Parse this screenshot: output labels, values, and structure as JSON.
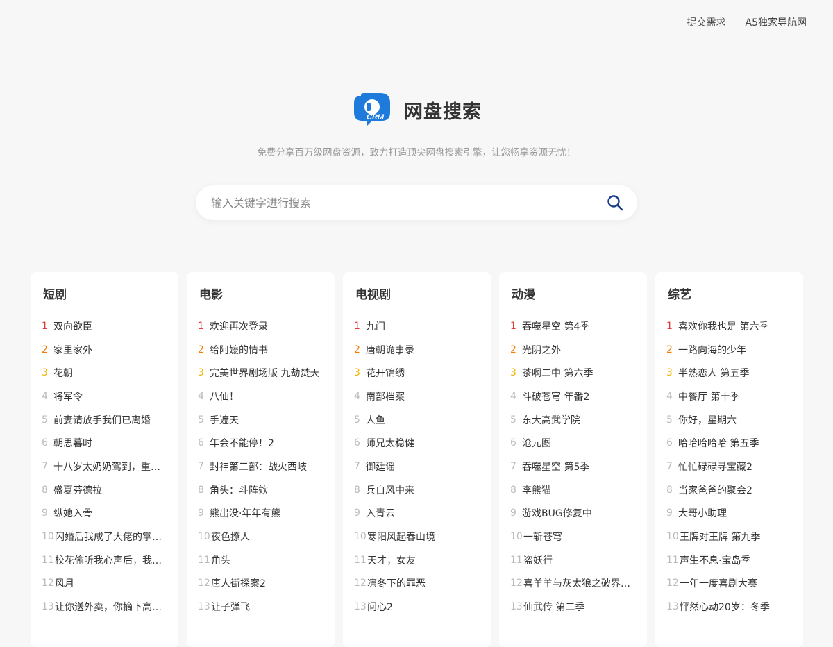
{
  "nav": {
    "links": [
      "提交需求",
      "A5独家导航网"
    ]
  },
  "brand": {
    "logo_text": "CRM",
    "title": "网盘搜索",
    "tagline": "免费分享百万级网盘资源，致力打造顶尖网盘搜索引擎，让您畅享资源无忧！"
  },
  "search": {
    "placeholder": "输入关键字进行搜索",
    "value": "",
    "icon": "search-icon"
  },
  "colors": {
    "accent": "#1e7bdc",
    "rank1": "#e53935",
    "rank2": "#f57c00",
    "rank3": "#f2b400"
  },
  "columns": [
    {
      "title": "短剧",
      "items": [
        {
          "rank": "1",
          "text": "双向欲臣"
        },
        {
          "rank": "2",
          "text": "家里家外"
        },
        {
          "rank": "3",
          "text": "花朝"
        },
        {
          "rank": "4",
          "text": "将军令"
        },
        {
          "rank": "5",
          "text": "前妻请放手我们已离婚"
        },
        {
          "rank": "6",
          "text": "朝思暮时"
        },
        {
          "rank": "7",
          "text": "十八岁太奶奶驾到，重…"
        },
        {
          "rank": "8",
          "text": "盛夏芬德拉"
        },
        {
          "rank": "9",
          "text": "纵她入骨"
        },
        {
          "rank": "10",
          "text": "闪婚后我成了大佬的掌…"
        },
        {
          "rank": "11",
          "text": "校花偷听我心声后，我…"
        },
        {
          "rank": "12",
          "text": "风月"
        },
        {
          "rank": "13",
          "text": "让你送外卖，你摘下高…"
        }
      ]
    },
    {
      "title": "电影",
      "items": [
        {
          "rank": "1",
          "text": "欢迎再次登录"
        },
        {
          "rank": "2",
          "text": "给阿嬷的情书"
        },
        {
          "rank": "3",
          "text": "完美世界剧场版 九劫焚天"
        },
        {
          "rank": "4",
          "text": "八仙！"
        },
        {
          "rank": "5",
          "text": "手遮天"
        },
        {
          "rank": "6",
          "text": "年会不能停！2"
        },
        {
          "rank": "7",
          "text": "封神第二部：战火西岐"
        },
        {
          "rank": "8",
          "text": "角头：斗阵欸"
        },
        {
          "rank": "9",
          "text": "熊出没·年年有熊"
        },
        {
          "rank": "10",
          "text": "夜色撩人"
        },
        {
          "rank": "11",
          "text": "角头"
        },
        {
          "rank": "12",
          "text": "唐人街探案2"
        },
        {
          "rank": "13",
          "text": "让子弹飞"
        }
      ]
    },
    {
      "title": "电视剧",
      "items": [
        {
          "rank": "1",
          "text": "九门"
        },
        {
          "rank": "2",
          "text": "唐朝诡事录"
        },
        {
          "rank": "3",
          "text": "花开锦绣"
        },
        {
          "rank": "4",
          "text": "南部档案"
        },
        {
          "rank": "5",
          "text": "人鱼"
        },
        {
          "rank": "6",
          "text": "师兄太稳健"
        },
        {
          "rank": "7",
          "text": "御廷谣"
        },
        {
          "rank": "8",
          "text": "兵自风中来"
        },
        {
          "rank": "9",
          "text": "入青云"
        },
        {
          "rank": "10",
          "text": "寒阳风起春山境"
        },
        {
          "rank": "11",
          "text": "天才，女友"
        },
        {
          "rank": "12",
          "text": "凛冬下的罪恶"
        },
        {
          "rank": "13",
          "text": "问心2"
        }
      ]
    },
    {
      "title": "动漫",
      "items": [
        {
          "rank": "1",
          "text": "吞噬星空 第4季"
        },
        {
          "rank": "2",
          "text": "光阴之外"
        },
        {
          "rank": "3",
          "text": "茶啊二中 第六季"
        },
        {
          "rank": "4",
          "text": "斗破苍穹 年番2"
        },
        {
          "rank": "5",
          "text": "东大高武学院"
        },
        {
          "rank": "6",
          "text": "沧元图"
        },
        {
          "rank": "7",
          "text": "吞噬星空 第5季"
        },
        {
          "rank": "8",
          "text": "李熊猫"
        },
        {
          "rank": "9",
          "text": "游戏BUG修复中"
        },
        {
          "rank": "10",
          "text": "一斩苍穹"
        },
        {
          "rank": "11",
          "text": "盗妖行"
        },
        {
          "rank": "12",
          "text": "喜羊羊与灰太狼之破界…"
        },
        {
          "rank": "13",
          "text": "仙武传 第二季"
        }
      ]
    },
    {
      "title": "综艺",
      "items": [
        {
          "rank": "1",
          "text": "喜欢你我也是 第六季"
        },
        {
          "rank": "2",
          "text": "一路向海的少年"
        },
        {
          "rank": "3",
          "text": "半熟恋人 第五季"
        },
        {
          "rank": "4",
          "text": "中餐厅 第十季"
        },
        {
          "rank": "5",
          "text": "你好，星期六"
        },
        {
          "rank": "6",
          "text": "哈哈哈哈哈 第五季"
        },
        {
          "rank": "7",
          "text": "忙忙碌碌寻宝藏2"
        },
        {
          "rank": "8",
          "text": "当家爸爸的聚会2"
        },
        {
          "rank": "9",
          "text": "大哥小助理"
        },
        {
          "rank": "10",
          "text": "王牌对王牌 第九季"
        },
        {
          "rank": "11",
          "text": "声生不息·宝岛季"
        },
        {
          "rank": "12",
          "text": "一年一度喜剧大赛"
        },
        {
          "rank": "13",
          "text": "怦然心动20岁：冬季"
        }
      ]
    }
  ]
}
